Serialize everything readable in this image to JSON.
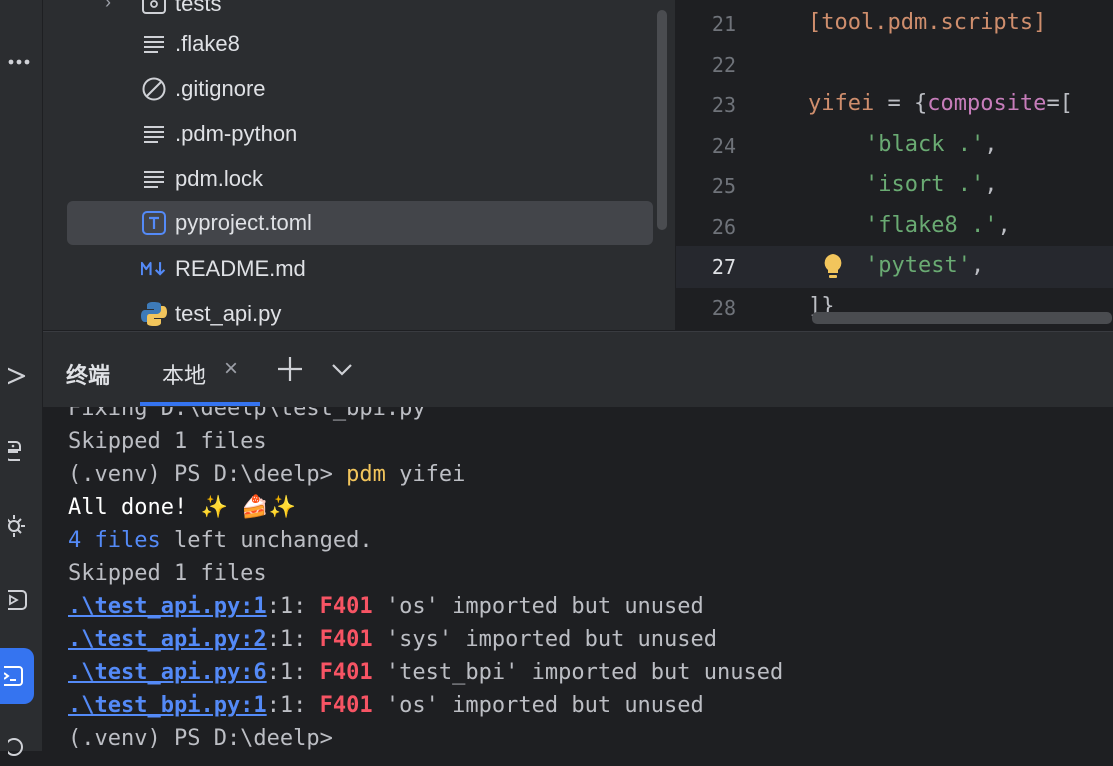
{
  "colors": {
    "accent": "#3574f0",
    "panel": "#2b2d30",
    "editor_bg": "#1e1f22",
    "string": "#6aab73",
    "keyword_orange": "#cf8e6d",
    "key_purple": "#c77dbb",
    "error_red": "#f75464",
    "link_blue": "#548af7",
    "command_yellow": "#f2c55c"
  },
  "activity_bar": {
    "icons": [
      "more-icon",
      "run-icon",
      "python-packages-icon",
      "services-icon",
      "run-config-icon",
      "terminal-icon",
      "vcs-icon"
    ]
  },
  "project_tree": {
    "items": [
      {
        "name": "tests",
        "icon": "folder-icon"
      },
      {
        "name": ".flake8",
        "icon": "text-file-icon"
      },
      {
        "name": ".gitignore",
        "icon": "ignore-file-icon"
      },
      {
        "name": ".pdm-python",
        "icon": "text-file-icon"
      },
      {
        "name": "pdm.lock",
        "icon": "text-file-icon"
      },
      {
        "name": "pyproject.toml",
        "icon": "toml-file-icon",
        "selected": true
      },
      {
        "name": "README.md",
        "icon": "markdown-file-icon"
      },
      {
        "name": "test_api.py",
        "icon": "python-file-icon"
      }
    ]
  },
  "editor": {
    "line_numbers": [
      "21",
      "22",
      "23",
      "24",
      "25",
      "26",
      "27",
      "28"
    ],
    "current_line": "27",
    "lines": {
      "l21": "[tool.pdm.scripts]",
      "l23_key": "yifei",
      "l23_op": " = {",
      "l23_sub": "composite",
      "l23_rest": "=[",
      "l24_str": "'black .'",
      "l24_punc": ",",
      "l25_str": "'isort .'",
      "l25_punc": ",",
      "l26_str": "'flake8 .'",
      "l26_punc": ",",
      "l27_str": "'pytest'",
      "l27_punc": ",",
      "l28": "]}"
    }
  },
  "terminal": {
    "title": "终端",
    "tab_label": "本地",
    "lines": {
      "l0": "Fixing D:\\deelp\\test_bpi.py",
      "l1": "Skipped 1 files",
      "l2_prompt": "(.venv) PS D:\\deelp> ",
      "l2_cmd": "pdm",
      "l2_arg": " yifei",
      "l3": "All done! ✨ 🍰✨",
      "l4_num": "4 files",
      "l4_rest": " left unchanged.",
      "l5": "Skipped 1 files",
      "errors": [
        {
          "link": ".\\test_api.py:1",
          "col": ":1: ",
          "code": "F401",
          "msg": " 'os' imported but unused"
        },
        {
          "link": ".\\test_api.py:2",
          "col": ":1: ",
          "code": "F401",
          "msg": " 'sys' imported but unused"
        },
        {
          "link": ".\\test_api.py:6",
          "col": ":1: ",
          "code": "F401",
          "msg": " 'test_bpi' imported but unused"
        },
        {
          "link": ".\\test_bpi.py:1",
          "col": ":1: ",
          "code": "F401",
          "msg": " 'os' imported but unused"
        }
      ],
      "last_prompt": "(.venv) PS D:\\deelp>"
    }
  }
}
